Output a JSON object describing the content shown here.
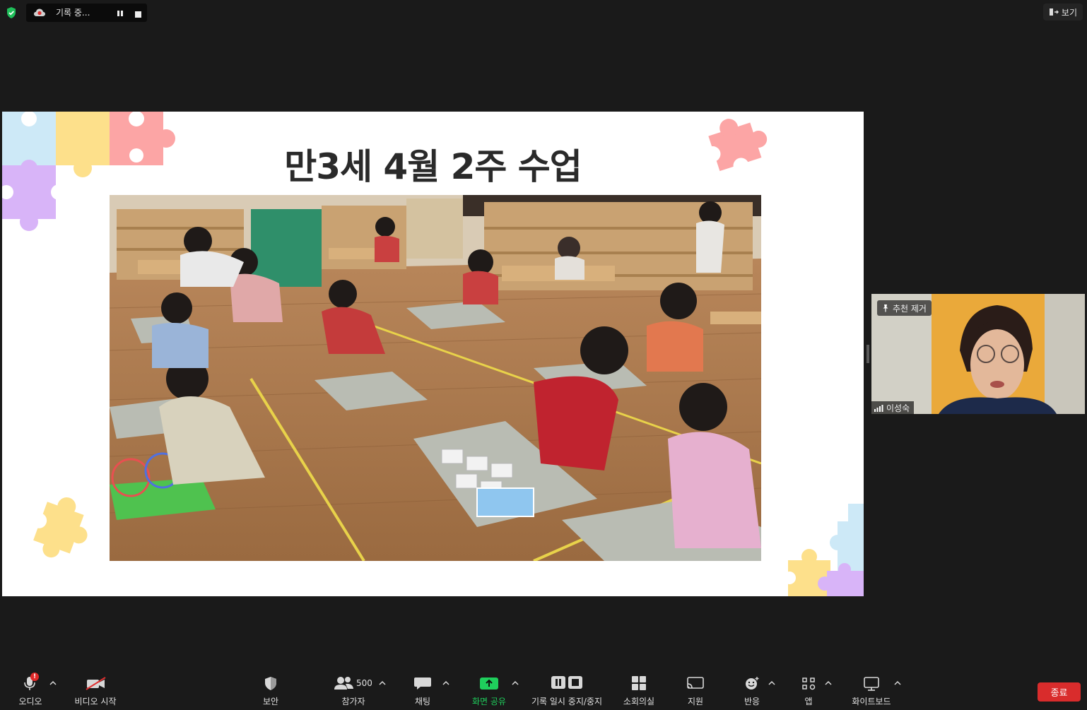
{
  "recording": {
    "label": "기록 중..."
  },
  "view_button": {
    "label": "보기"
  },
  "slide": {
    "title": "만3세 4월 2주 수업"
  },
  "participant": {
    "name": "이성숙",
    "pin_label": "추천 제거"
  },
  "toolbar": {
    "audio": "오디오",
    "video": "비디오 시작",
    "security": "보안",
    "participants": "참가자",
    "participants_count": "500",
    "chat": "채팅",
    "share": "화면 공유",
    "recording_ctrl": "기록 일시 중지/중지",
    "breakout": "소회의실",
    "support": "지원",
    "reactions": "반응",
    "apps": "앱",
    "whiteboard": "화이트보드",
    "end": "종료",
    "audio_badge": "!"
  },
  "colors": {
    "background": "#1a1a1a",
    "share_green": "#1fcf5c",
    "end_red": "#d92c2c",
    "shield_green": "#1fbf5a"
  }
}
